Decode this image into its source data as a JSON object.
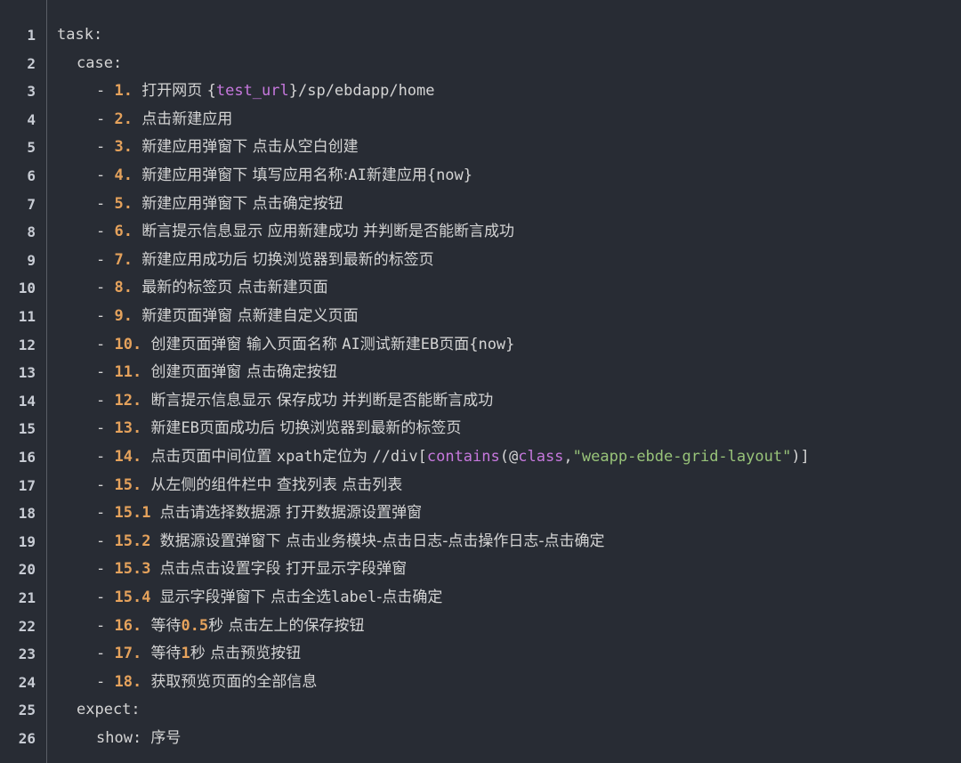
{
  "editor": {
    "background": "#282c34",
    "lines": [
      {
        "n": "1",
        "indent": 0,
        "segs": [
          [
            "key",
            "task:"
          ]
        ]
      },
      {
        "n": "2",
        "indent": 1,
        "segs": [
          [
            "key",
            "case:"
          ]
        ]
      },
      {
        "n": "3",
        "indent": 2,
        "segs": [
          [
            "key",
            "- "
          ],
          [
            "num",
            "1. "
          ],
          [
            "txt",
            "打开网页 "
          ],
          [
            "plain",
            "{"
          ],
          [
            "var",
            "test_url"
          ],
          [
            "plain",
            "}/sp/ebdapp/home"
          ]
        ]
      },
      {
        "n": "4",
        "indent": 2,
        "segs": [
          [
            "key",
            "- "
          ],
          [
            "num",
            "2. "
          ],
          [
            "txt",
            "点击新建应用"
          ]
        ]
      },
      {
        "n": "5",
        "indent": 2,
        "segs": [
          [
            "key",
            "- "
          ],
          [
            "num",
            "3. "
          ],
          [
            "txt",
            "新建应用弹窗下 点击从空白创建"
          ]
        ]
      },
      {
        "n": "6",
        "indent": 2,
        "segs": [
          [
            "key",
            "- "
          ],
          [
            "num",
            "4. "
          ],
          [
            "txt",
            "新建应用弹窗下 填写应用名称:"
          ],
          [
            "plain",
            "AI"
          ],
          [
            "txt",
            "新建应用"
          ],
          [
            "plain",
            "{now}"
          ]
        ]
      },
      {
        "n": "7",
        "indent": 2,
        "segs": [
          [
            "key",
            "- "
          ],
          [
            "num",
            "5. "
          ],
          [
            "txt",
            "新建应用弹窗下 点击确定按钮"
          ]
        ]
      },
      {
        "n": "8",
        "indent": 2,
        "segs": [
          [
            "key",
            "- "
          ],
          [
            "num",
            "6. "
          ],
          [
            "txt",
            "断言提示信息显示 应用新建成功 并判断是否能断言成功"
          ]
        ]
      },
      {
        "n": "9",
        "indent": 2,
        "segs": [
          [
            "key",
            "- "
          ],
          [
            "num",
            "7. "
          ],
          [
            "txt",
            "新建应用成功后 切换浏览器到最新的标签页"
          ]
        ]
      },
      {
        "n": "10",
        "indent": 2,
        "segs": [
          [
            "key",
            "- "
          ],
          [
            "num",
            "8. "
          ],
          [
            "txt",
            "最新的标签页 点击新建页面"
          ]
        ]
      },
      {
        "n": "11",
        "indent": 2,
        "segs": [
          [
            "key",
            "- "
          ],
          [
            "num",
            "9. "
          ],
          [
            "txt",
            "新建页面弹窗 点新建自定义页面"
          ]
        ]
      },
      {
        "n": "12",
        "indent": 2,
        "segs": [
          [
            "key",
            "- "
          ],
          [
            "num",
            "10. "
          ],
          [
            "txt",
            "创建页面弹窗 输入页面名称 "
          ],
          [
            "plain",
            "AI"
          ],
          [
            "txt",
            "测试新建"
          ],
          [
            "plain",
            "EB"
          ],
          [
            "txt",
            "页面"
          ],
          [
            "plain",
            "{now}"
          ]
        ]
      },
      {
        "n": "13",
        "indent": 2,
        "segs": [
          [
            "key",
            "- "
          ],
          [
            "num",
            "11. "
          ],
          [
            "txt",
            "创建页面弹窗 点击确定按钮"
          ]
        ]
      },
      {
        "n": "14",
        "indent": 2,
        "segs": [
          [
            "key",
            "- "
          ],
          [
            "num",
            "12. "
          ],
          [
            "txt",
            "断言提示信息显示 保存成功 并判断是否能断言成功"
          ]
        ]
      },
      {
        "n": "15",
        "indent": 2,
        "segs": [
          [
            "key",
            "- "
          ],
          [
            "num",
            "13. "
          ],
          [
            "txt",
            "新建"
          ],
          [
            "plain",
            "EB"
          ],
          [
            "txt",
            "页面成功后 切换浏览器到最新的标签页"
          ]
        ]
      },
      {
        "n": "16",
        "indent": 2,
        "segs": [
          [
            "key",
            "- "
          ],
          [
            "num",
            "14. "
          ],
          [
            "txt",
            "点击页面中间位置 "
          ],
          [
            "plain",
            "xpath"
          ],
          [
            "txt",
            "定位为 "
          ],
          [
            "plain",
            "//div["
          ],
          [
            "fn",
            "contains"
          ],
          [
            "plain",
            "(@"
          ],
          [
            "fn",
            "class"
          ],
          [
            "plain",
            ","
          ],
          [
            "str",
            "\"weapp-ebde-grid-layout\""
          ],
          [
            "plain",
            ")]"
          ]
        ]
      },
      {
        "n": "17",
        "indent": 2,
        "segs": [
          [
            "key",
            "- "
          ],
          [
            "num",
            "15. "
          ],
          [
            "txt",
            "从左侧的组件栏中 查找列表 点击列表"
          ]
        ]
      },
      {
        "n": "18",
        "indent": 2,
        "segs": [
          [
            "key",
            "- "
          ],
          [
            "num",
            "15.1 "
          ],
          [
            "txt",
            "点击请选择数据源 打开数据源设置弹窗"
          ]
        ]
      },
      {
        "n": "19",
        "indent": 2,
        "segs": [
          [
            "key",
            "- "
          ],
          [
            "num",
            "15.2 "
          ],
          [
            "txt",
            "数据源设置弹窗下 点击业务模块-点击日志-点击操作日志-点击确定"
          ]
        ]
      },
      {
        "n": "20",
        "indent": 2,
        "segs": [
          [
            "key",
            "- "
          ],
          [
            "num",
            "15.3 "
          ],
          [
            "txt",
            "点击点击设置字段 打开显示字段弹窗"
          ]
        ]
      },
      {
        "n": "21",
        "indent": 2,
        "segs": [
          [
            "key",
            "- "
          ],
          [
            "num",
            "15.4 "
          ],
          [
            "txt",
            "显示字段弹窗下 点击全选"
          ],
          [
            "plain",
            "label"
          ],
          [
            "txt",
            "-点击确定"
          ]
        ]
      },
      {
        "n": "22",
        "indent": 2,
        "segs": [
          [
            "key",
            "- "
          ],
          [
            "num",
            "16. "
          ],
          [
            "txt",
            "等待"
          ],
          [
            "bold",
            "0.5"
          ],
          [
            "txt",
            "秒 点击左上的保存按钮"
          ]
        ]
      },
      {
        "n": "23",
        "indent": 2,
        "segs": [
          [
            "key",
            "- "
          ],
          [
            "num",
            "17. "
          ],
          [
            "txt",
            "等待"
          ],
          [
            "bold",
            "1"
          ],
          [
            "txt",
            "秒 点击预览按钮"
          ]
        ]
      },
      {
        "n": "24",
        "indent": 2,
        "segs": [
          [
            "key",
            "- "
          ],
          [
            "num",
            "18. "
          ],
          [
            "txt",
            "获取预览页面的全部信息"
          ]
        ]
      },
      {
        "n": "25",
        "indent": 1,
        "segs": [
          [
            "key",
            "expect:"
          ]
        ]
      },
      {
        "n": "26",
        "indent": 2,
        "segs": [
          [
            "key",
            "show: "
          ],
          [
            "txt",
            "序号"
          ]
        ]
      }
    ]
  }
}
